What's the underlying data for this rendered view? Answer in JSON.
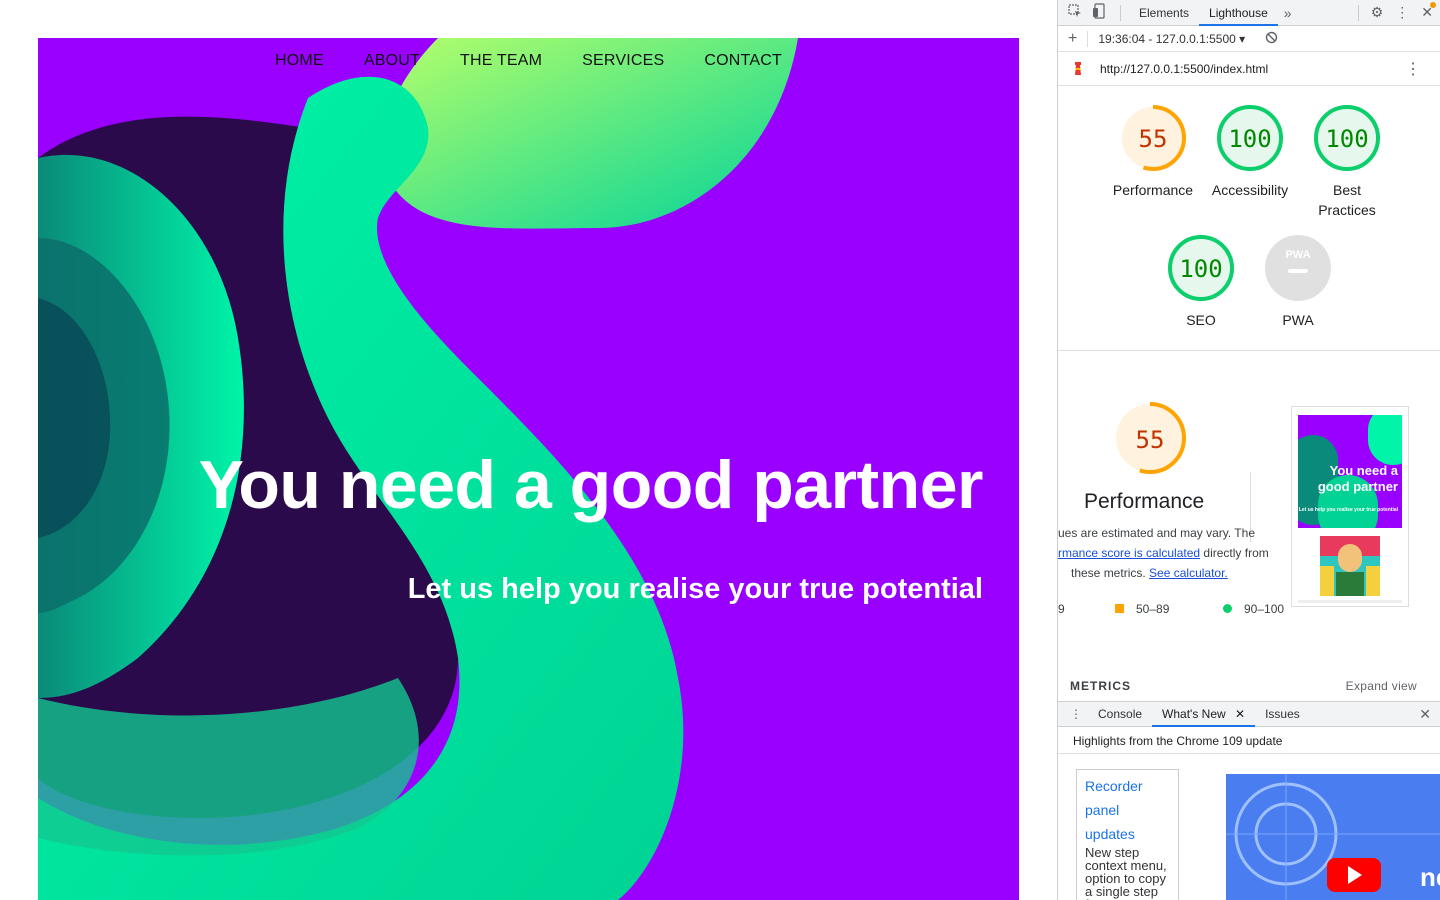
{
  "site": {
    "nav": [
      "HOME",
      "ABOUT",
      "THE TEAM",
      "SERVICES",
      "CONTACT"
    ],
    "hero_title": "You need a good partner",
    "hero_subtitle": "Let us help you realise your true potential",
    "colors": {
      "background": "#9a00ff",
      "shape": "#00f5a8",
      "shape_dark": "#2a0a4a",
      "text": "#ffffff"
    }
  },
  "devtools": {
    "tabs": [
      "Elements",
      "Lighthouse"
    ],
    "active_tab": "Lighthouse",
    "report_selector": "19:36:04 - 127.0.0.1:5500",
    "url": "http://127.0.0.1:5500/index.html",
    "scores": [
      {
        "label": "Performance",
        "value": "55",
        "status": "average"
      },
      {
        "label": "Accessibility",
        "value": "100",
        "status": "pass"
      },
      {
        "label": "Best Practices",
        "value": "100",
        "status": "pass"
      },
      {
        "label": "SEO",
        "value": "100",
        "status": "pass"
      },
      {
        "label": "PWA",
        "value": "PWA",
        "status": "na"
      }
    ],
    "perf_detail": {
      "score": "55",
      "title": "Performance",
      "line1": "ues are estimated and may vary. The",
      "line2_link": "rmance score is calculated",
      "line2_rest": "directly from",
      "line3": "these metrics.",
      "line3_link": "See calculator.",
      "legend": [
        "9",
        "50–89",
        "90–100"
      ],
      "thumb_title": "You need a good partner",
      "thumb_sub": "Let us help you realise your true potential"
    },
    "metrics_label": "METRICS",
    "expand_view": "Expand view",
    "drawer_tabs": [
      "Console",
      "What's New",
      "Issues"
    ],
    "drawer_active": "What's New",
    "drawer_heading": "Highlights from the Chrome 109 update",
    "news_card": {
      "title": "Recorder panel updates",
      "text": "New step context menu, option to copy a single step from a"
    },
    "news_video_text": "ne",
    "colors": {
      "pass": "#0cce6b",
      "average": "#ffa400",
      "fail": "#ff4e42",
      "accent": "#1a73e8"
    }
  }
}
